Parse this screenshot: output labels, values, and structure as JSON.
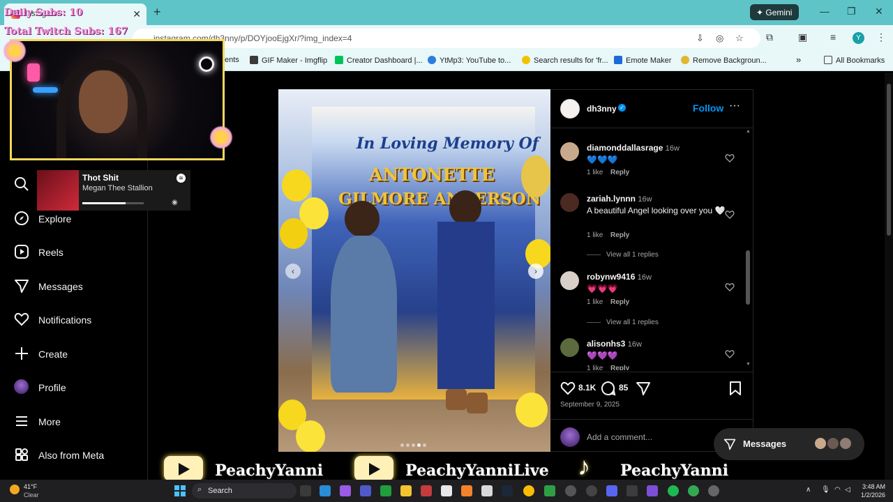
{
  "browser": {
    "tab_title": "Instagram",
    "url": "instagram.com/dh3nny/p/DOYjooEjgXr/?img_index=4",
    "gemini_label": "Gemini",
    "profile_initial": "Y",
    "bookmarks": [
      "ents",
      "GIF Maker - Imgflip",
      "Creator Dashboard |...",
      "YtMp3: YouTube to...",
      "Search results for 'fr...",
      "Emote Maker",
      "Remove Backgroun..."
    ],
    "all_bookmarks_label": "All Bookmarks"
  },
  "stream": {
    "daily_subs": "Daily Subs: 10",
    "total_subs": "Total Twitch Subs: 167"
  },
  "spotify": {
    "track": "Thot Shit",
    "artist": "Megan Thee Stallion",
    "progress": 0.71
  },
  "sidebar": {
    "items": [
      {
        "label": "Explore",
        "icon": "compass-icon"
      },
      {
        "label": "Reels",
        "icon": "reels-icon"
      },
      {
        "label": "Messages",
        "icon": "send-icon"
      },
      {
        "label": "Notifications",
        "icon": "heart-icon"
      },
      {
        "label": "Create",
        "icon": "plus-icon"
      },
      {
        "label": "Profile",
        "icon": "avatar"
      },
      {
        "label": "More",
        "icon": "menu-icon"
      },
      {
        "label": "Also from Meta",
        "icon": "meta-grid-icon"
      }
    ]
  },
  "post": {
    "username": "dh3nny",
    "follow_label": "Follow",
    "banner_line1": "In Loving Memory Of",
    "banner_line2": "ANTONETTE",
    "banner_line3": "GILMORE ANDERSON",
    "comments": [
      {
        "user": "diamonddallasrage",
        "age": "16w",
        "text": "💙💙💙",
        "likes": "1 like",
        "reply": "Reply"
      },
      {
        "user": "zariah.lynnn",
        "age": "16w",
        "text": "A beautiful Angel looking over you 🤍",
        "likes": "1 like",
        "reply": "Reply",
        "view_replies": "View all 1 replies"
      },
      {
        "user": "robynw9416",
        "age": "16w",
        "text": "💗💗💗",
        "likes": "1 like",
        "reply": "Reply",
        "view_replies": "View all 1 replies"
      },
      {
        "user": "alisonhs3",
        "age": "16w",
        "text": "💜💜💜",
        "likes": "1 like",
        "reply": "Reply"
      }
    ],
    "like_count": "8.1K",
    "comment_count": "85",
    "date": "September 9, 2025",
    "add_comment_placeholder": "Add a comment...",
    "carousel_index": 4,
    "carousel_total": 5
  },
  "messages_pill": {
    "label": "Messages"
  },
  "social": [
    "PeachyYanni",
    "PeachyYanniLive",
    "PeachyYanni"
  ],
  "taskbar": {
    "weather_temp": "41°F",
    "weather_desc": "Clear",
    "search_label": "Search",
    "time": "3:48 AM",
    "date": "1/2/2026"
  },
  "colors": {
    "accent_follow": "#0095f6",
    "titlebar": "#5fc4c8",
    "frame_gold": "#f6d85a",
    "overlay_pink": "#f08ad6"
  }
}
